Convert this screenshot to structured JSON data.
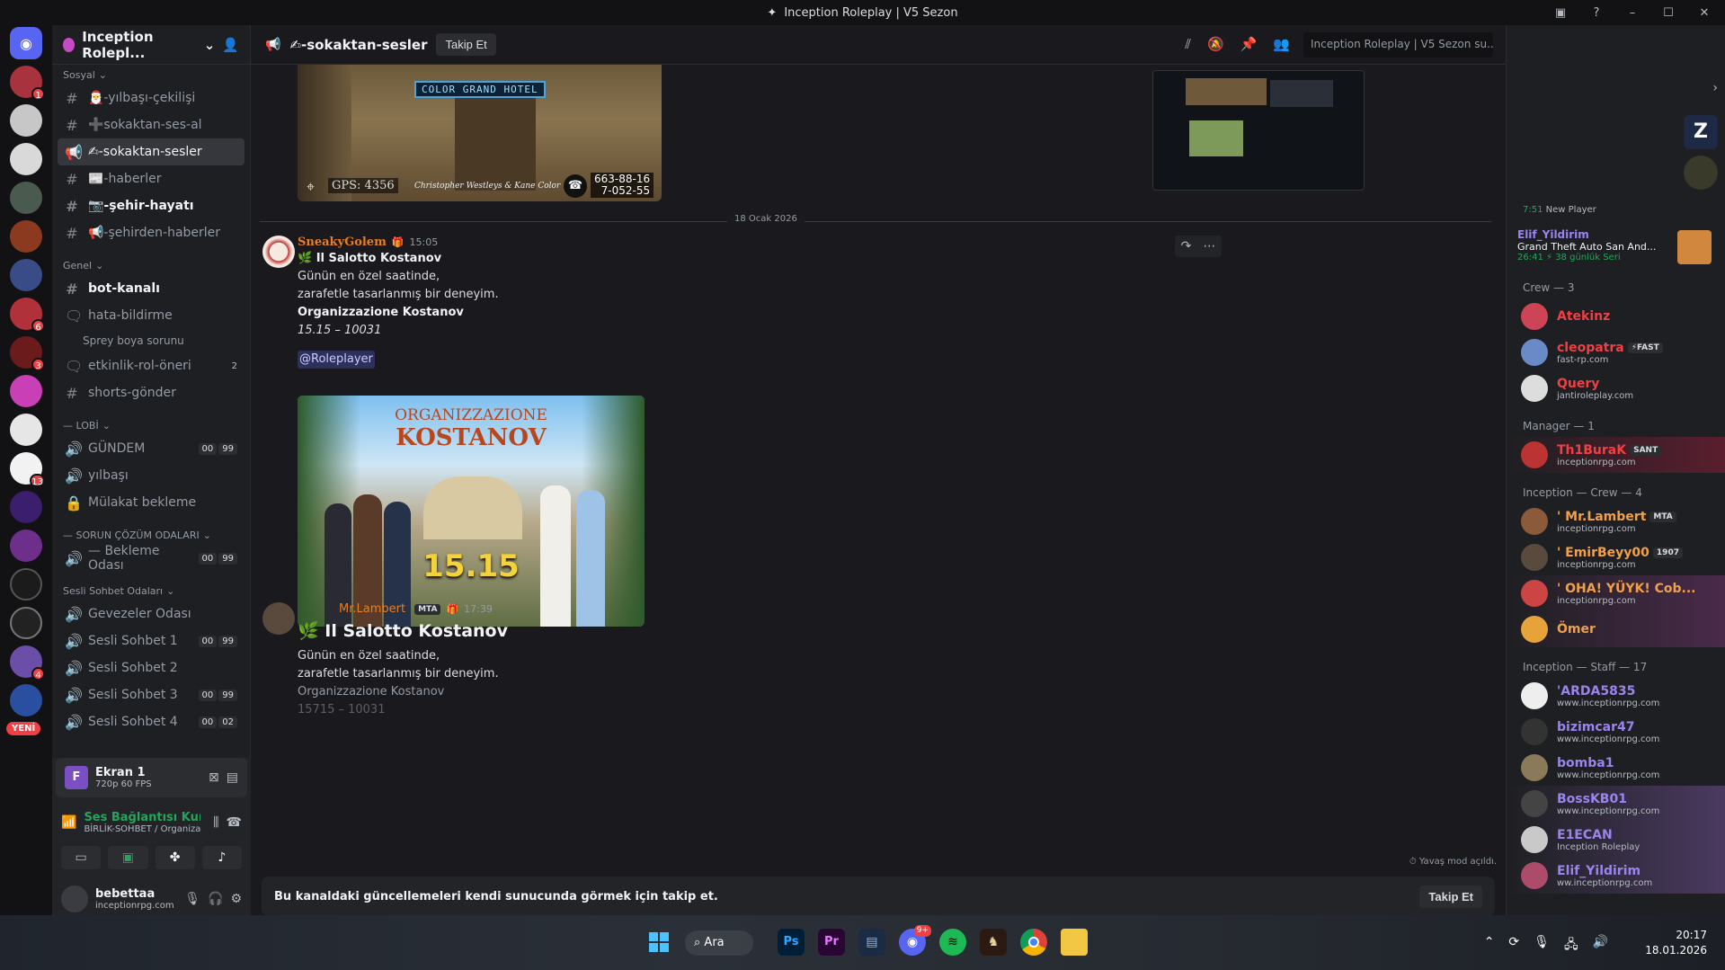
{
  "window": {
    "title": "Inception Roleplay | V5 Sezon"
  },
  "guild": {
    "name": "Inception Rolepl..."
  },
  "channels": [
    {
      "type": "cat",
      "label": "Sosyal"
    },
    {
      "type": "text",
      "label": "🎅-yılbaşı-çekilişi"
    },
    {
      "type": "text",
      "label": "➕sokaktan-ses-al"
    },
    {
      "type": "announce",
      "label": "✍-sokaktan-sesler",
      "active": true
    },
    {
      "type": "text",
      "label": "📰-haberler"
    },
    {
      "type": "text",
      "label": "📷-şehir-hayatı",
      "unread": true
    },
    {
      "type": "text",
      "label": "📢-şehirden-haberler"
    },
    {
      "type": "cat",
      "label": "Genel"
    },
    {
      "type": "text",
      "label": "bot-kanalı",
      "unread": true
    },
    {
      "type": "forum",
      "label": "hata-bildirme"
    },
    {
      "type": "sub",
      "label": "Sprey boya sorunu"
    },
    {
      "type": "forum",
      "label": "etkinlik-rol-öneri",
      "count": "2"
    },
    {
      "type": "text",
      "label": "shorts-gönder"
    },
    {
      "type": "cat",
      "label": "— LOBİ"
    },
    {
      "type": "voice",
      "label": "GÜNDEM",
      "counts": [
        "00",
        "99"
      ]
    },
    {
      "type": "voice",
      "label": "yılbaşı"
    },
    {
      "type": "lock",
      "label": "Mülakat bekleme"
    },
    {
      "type": "cat",
      "label": "— SORUN ÇÖZÜM ODALARI"
    },
    {
      "type": "voice",
      "label": "— Bekleme Odası",
      "counts": [
        "00",
        "99"
      ]
    },
    {
      "type": "cat",
      "label": "Sesli Sohbet Odaları"
    },
    {
      "type": "voice",
      "label": "Gevezeler Odası"
    },
    {
      "type": "voice",
      "label": "Sesli Sohbet 1",
      "counts": [
        "00",
        "99"
      ]
    },
    {
      "type": "voice",
      "label": "Sesli Sohbet 2"
    },
    {
      "type": "voice",
      "label": "Sesli Sohbet 3",
      "counts": [
        "00",
        "99"
      ]
    },
    {
      "type": "voice",
      "label": "Sesli Sohbet 4",
      "counts": [
        "00",
        "02"
      ]
    }
  ],
  "rail": {
    "new_badge": "YENİ",
    "pings": [
      "1",
      "6",
      "3",
      "13",
      "4"
    ]
  },
  "stream": {
    "title": "Ekran 1",
    "quality": "720p 60 FPS",
    "letter": "F"
  },
  "voice_status": {
    "title": "Ses Bağlantısı Kuruldu",
    "channel": "BİRLİK-SOHBET / Organizaz..."
  },
  "user": {
    "name": "bebettaa",
    "status": "inceptionrpg.com"
  },
  "header": {
    "channel": "✍-sokaktan-sesler",
    "follow": "Takip Et",
    "search": "Inception Roleplay | V5 Sezon su..."
  },
  "top_image": {
    "hotel": "COLOR GRAND HOTEL",
    "gps": "GPS: 4356",
    "credit": "Christopher Westleys & Kane Color",
    "phone1": "663-88-16",
    "phone2": "7-052-55"
  },
  "divider": "18 Ocak 2026",
  "msg1": {
    "author": "SneakyGolem",
    "time": "15:05",
    "title": "🌿 Il Salotto Kostanov",
    "line1": "Günün en özel saatinde,",
    "line2": "zarafetle tasarlanmış bir deneyim.",
    "org": "Organizzazione Kostanov",
    "hours": "15.15 – 10031",
    "mention": "@Roleplayer"
  },
  "poster": {
    "line1": "ORGANIZZAZIONE",
    "line2": "KOSTANOV",
    "time": "15.15"
  },
  "msg2": {
    "author": "Mr.Lambert",
    "tag": "MTA",
    "time": "17:39",
    "title": "🌿 Il Salotto Kostanov",
    "line1": "Günün en özel saatinde,",
    "line2": "zarafetle tasarlanmış bir deneyim.",
    "org": "Organizzazione Kostanov",
    "hours": "15715 – 10031"
  },
  "slowmode": "Yavaş mod açıldı.",
  "composer": {
    "text": "Bu kanaldaki güncellemeleri kendi sunucunda görmek için takip et.",
    "button": "Takip Et"
  },
  "members": {
    "top": [
      {
        "name": "7:51",
        "sub": "New Player"
      },
      {
        "name": "Elif_Yildirim",
        "sub": "Grand Theft Auto San And...",
        "sub2": "26:41 ⚡ 38 günlük Seri"
      }
    ],
    "groups": [
      {
        "title": "Crew — 3",
        "items": [
          {
            "name": "Atekinz",
            "color": "#f23f43",
            "sub": ""
          },
          {
            "name": "cleopatra",
            "color": "#f23f43",
            "tag": "⚡FAST",
            "sub": "fast-rp.com"
          },
          {
            "name": "Query",
            "color": "#f23f43",
            "sub": "jantiroleplay.com"
          }
        ]
      },
      {
        "title": "Manager — 1",
        "items": [
          {
            "name": "Th1BuraK",
            "color": "#f23f43",
            "tag": "SANT",
            "sub": "inceptionrpg.com"
          }
        ]
      },
      {
        "title": "Inception — Crew — 4",
        "items": [
          {
            "name": "' Mr.Lambert",
            "color": "#f0a04b",
            "tag": "MTA",
            "sub": "inceptionrpg.com"
          },
          {
            "name": "' EmirBeyy00",
            "color": "#f0a04b",
            "tag": "1907",
            "sub": "inceptionrpg.com"
          },
          {
            "name": "' OHA! YÜYK! Cob...",
            "color": "#f0a04b",
            "sub": "inceptionrpg.com"
          },
          {
            "name": "Ömer",
            "color": "#f0a04b",
            "sub": ""
          }
        ]
      },
      {
        "title": "Inception — Staff — 17",
        "items": [
          {
            "name": "'ARDA5835",
            "color": "#9b84ee",
            "sub": "www.inceptionrpg.com"
          },
          {
            "name": "bizimcar47",
            "color": "#9b84ee",
            "sub": "www.inceptionrpg.com"
          },
          {
            "name": "bomba1",
            "color": "#9b84ee",
            "sub": "www.inceptionrpg.com"
          },
          {
            "name": "BossKB01",
            "color": "#9b84ee",
            "sub": "www.inceptionrpg.com"
          },
          {
            "name": "E1ECAN",
            "color": "#9b84ee",
            "sub": "Inception Roleplay"
          },
          {
            "name": "Elif_Yildirim",
            "color": "#9b84ee",
            "sub": "ww.inceptionrpg.com"
          }
        ]
      }
    ]
  },
  "taskbar": {
    "search": "Ara",
    "time": "20:17",
    "date": "18.01.2026",
    "discord_badge": "9+"
  }
}
